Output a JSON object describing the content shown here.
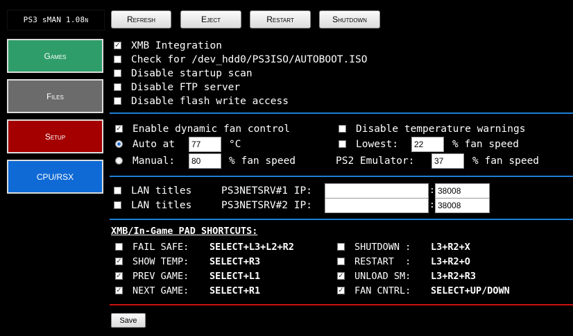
{
  "app_title": "PS3 sMAN 1.08",
  "app_title_suffix": "N",
  "toolbar": {
    "refresh": "Refresh",
    "eject": "Eject",
    "restart": "Restart",
    "shutdown": "Shutdown"
  },
  "sidebar": {
    "items": [
      {
        "label": "Games",
        "color": "#2e9d6a"
      },
      {
        "label": "Files",
        "color": "#6b6b6b"
      },
      {
        "label": "Setup",
        "color": "#a50000"
      },
      {
        "label": "CPU/RSX",
        "color": "#0f6ad6"
      }
    ]
  },
  "options": [
    {
      "label": "XMB Integration",
      "checked": true
    },
    {
      "label": "Check for /dev_hdd0/PS3ISO/AUTOBOOT.ISO",
      "checked": false
    },
    {
      "label": "Disable startup scan",
      "checked": false
    },
    {
      "label": "Disable FTP server",
      "checked": false
    },
    {
      "label": "Disable flash write access",
      "checked": false
    }
  ],
  "fan": {
    "dynamic_label": "Enable dynamic fan control",
    "dynamic_checked": true,
    "auto_label": "Auto at",
    "auto_value": "77",
    "auto_unit": "°C",
    "manual_label": "Manual:",
    "manual_value": "80",
    "manual_unit": "% fan speed",
    "disable_temp_label": "Disable temperature warnings",
    "disable_temp_checked": false,
    "lowest_label": "Lowest:",
    "lowest_value": "22",
    "lowest_unit": "% fan speed",
    "lowest_checked": false,
    "ps2_label": "PS2 Emulator:",
    "ps2_value": "37",
    "ps2_unit": "% fan speed"
  },
  "lan": [
    {
      "label": "LAN titles",
      "server": "PS3NETSRV#1 IP:",
      "ip": "",
      "port": "38008",
      "checked": false
    },
    {
      "label": "LAN titles",
      "server": "PS3NETSRV#2 IP:",
      "ip": "",
      "port": "38008",
      "checked": false
    }
  ],
  "shortcuts": {
    "title": "XMB/In-Game PAD SHORTCUTS:",
    "left": [
      {
        "label": "FAIL SAFE:",
        "combo": "SELECT+L3+L2+R2",
        "checked": false
      },
      {
        "label": "SHOW TEMP:",
        "combo": "SELECT+R3",
        "checked": true
      },
      {
        "label": "PREV GAME:",
        "combo": "SELECT+L1",
        "checked": true
      },
      {
        "label": "NEXT GAME:",
        "combo": "SELECT+R1",
        "checked": true
      }
    ],
    "right": [
      {
        "label": "SHUTDOWN :",
        "combo": "L3+R2+X",
        "checked": false
      },
      {
        "label": "RESTART  :",
        "combo": "L3+R2+O",
        "checked": false
      },
      {
        "label": "UNLOAD SM:",
        "combo": "L3+R2+R3",
        "checked": true
      },
      {
        "label": "FAN CNTRL:",
        "combo": "SELECT+UP/DOWN",
        "checked": true
      }
    ]
  },
  "save_label": "Save",
  "colors": {
    "separator_blue": "#1e7fd6",
    "separator_red": "#cc1111"
  }
}
